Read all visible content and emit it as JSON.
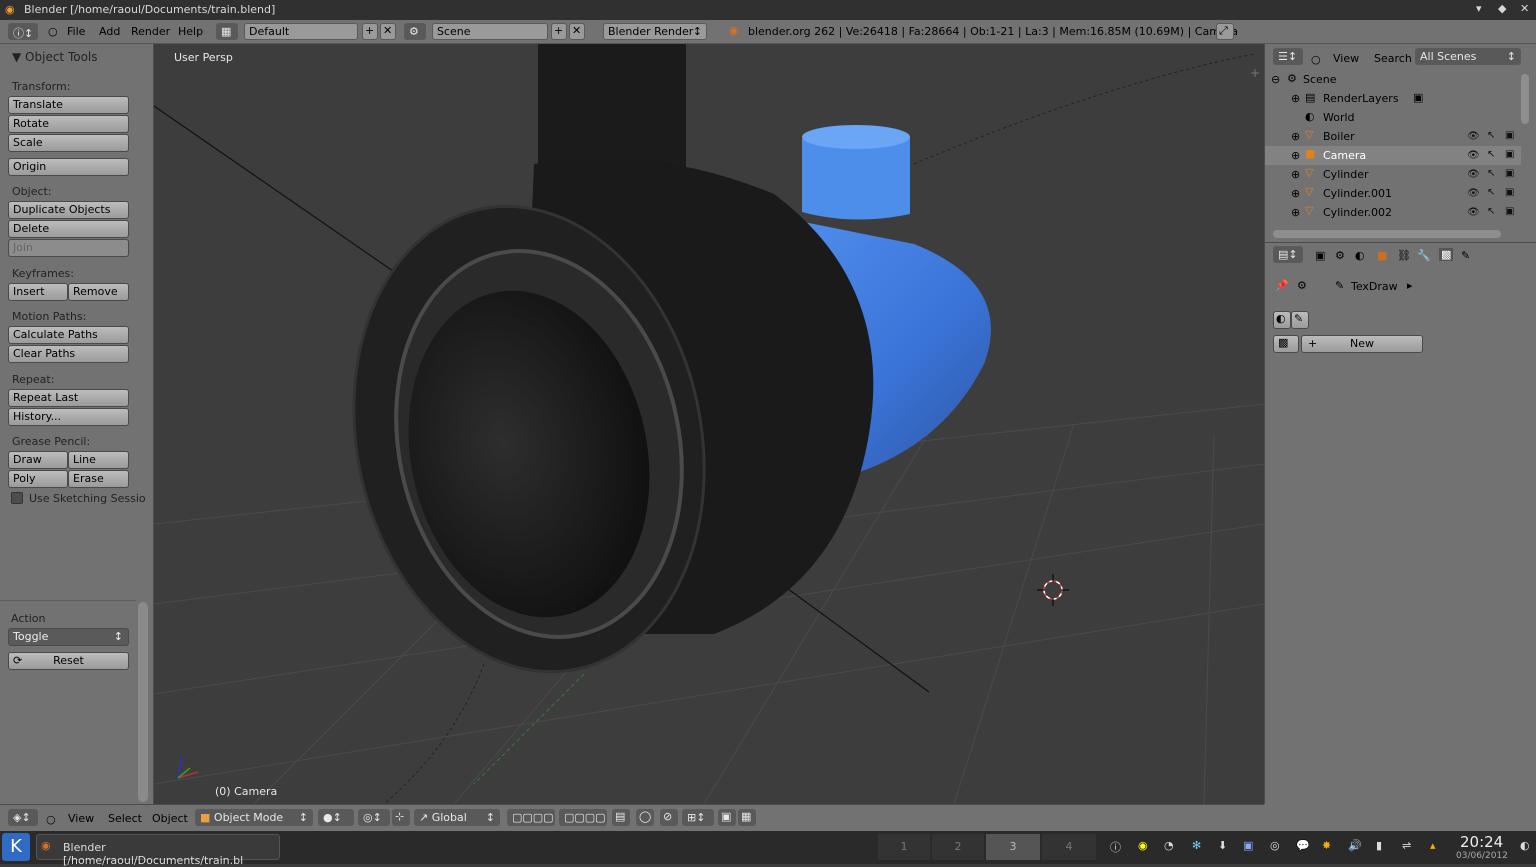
{
  "titlebar": {
    "title": "Blender [/home/raoul/Documents/train.blend]"
  },
  "info": {
    "menus": [
      "File",
      "Add",
      "Render",
      "Help"
    ],
    "layout": "Default",
    "scene": "Scene",
    "engine": "Blender Render",
    "stats": "blender.org 262 | Ve:26418 | Fa:28664 | Ob:1-21 | La:3 | Mem:16.85M (10.69M) | Camera"
  },
  "toolshelf": {
    "header": "Object Tools",
    "transform_label": "Transform:",
    "translate": "Translate",
    "rotate": "Rotate",
    "scale": "Scale",
    "origin": "Origin",
    "object_label": "Object:",
    "duplicate": "Duplicate Objects",
    "delete": "Delete",
    "join": "Join",
    "keyframes_label": "Keyframes:",
    "insert": "Insert",
    "remove": "Remove",
    "motion_label": "Motion Paths:",
    "calc_paths": "Calculate Paths",
    "clear_paths": "Clear Paths",
    "repeat_label": "Repeat:",
    "repeat_last": "Repeat Last",
    "history": "History...",
    "grease_label": "Grease Pencil:",
    "draw": "Draw",
    "line": "Line",
    "poly": "Poly",
    "erase": "Erase",
    "sketch": "Use Sketching Sessio",
    "action_label": "Action",
    "action_value": "Toggle",
    "reset": "Reset"
  },
  "viewport": {
    "view_name": "User Persp",
    "object_label": "(0) Camera"
  },
  "outliner": {
    "view": "View",
    "search": "Search",
    "filter": "All Scenes",
    "items": [
      {
        "name": "Scene"
      },
      {
        "name": "RenderLayers"
      },
      {
        "name": "World"
      },
      {
        "name": "Boiler"
      },
      {
        "name": "Camera"
      },
      {
        "name": "Cylinder"
      },
      {
        "name": "Cylinder.001"
      },
      {
        "name": "Cylinder.002"
      }
    ]
  },
  "properties": {
    "brush": "TexDraw",
    "new_button": "New"
  },
  "vheader": {
    "menus": [
      "View",
      "Select",
      "Object"
    ],
    "mode": "Object Mode",
    "orientation": "Global"
  },
  "taskbar": {
    "window": "Blender [/home/raoul/Documents/train.bl",
    "desktops": [
      "1",
      "2",
      "3",
      "4"
    ],
    "clock_time": "20:24",
    "clock_date": "03/06/2012"
  },
  "colors": {
    "boiler_blue": "#3f7fe0",
    "viewport_bg": "#3d3d3d",
    "panel_gray": "#727272"
  }
}
